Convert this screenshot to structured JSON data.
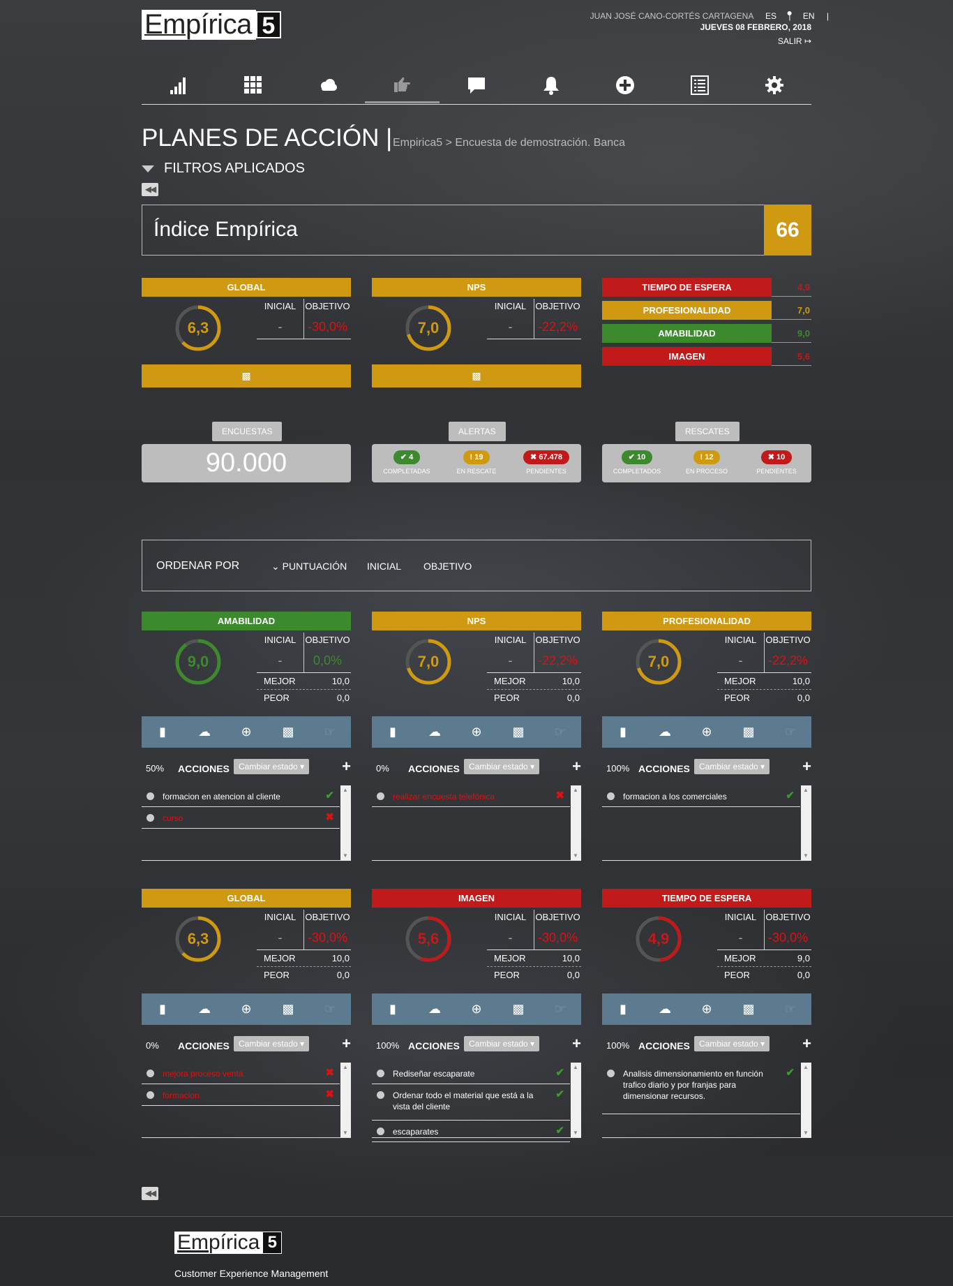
{
  "header": {
    "logo_word": "Empírica",
    "logo_num": "5",
    "user": "JUAN JOSÉ CANO-CORTÉS CARTAGENA",
    "lang_es": "ES",
    "lang_en": "EN",
    "sep": "|",
    "date": "JUEVES 08 FEBRERO, 2018",
    "logout": "SALIR"
  },
  "nav": [
    "bars-chart-icon",
    "grid-icon",
    "cloud-icon",
    "hand-pointer-icon",
    "speech-bubble-icon",
    "bell-icon",
    "plus-circle-icon",
    "list-icon",
    "gear-icon"
  ],
  "page": {
    "title": "PLANES DE ACCIÓN |",
    "breadcrumb": "Empirica5 > Encuesta de demostración. Banca",
    "filters": "FILTROS APLICADOS"
  },
  "indice": {
    "label": "Índice Empírica",
    "value": "66"
  },
  "kpi": [
    {
      "name": "GLOBAL",
      "score": "6,3",
      "inicial": "-",
      "objetivo": "-30,0%",
      "level": 0.63
    },
    {
      "name": "NPS",
      "score": "7,0",
      "inicial": "-",
      "objetivo": "-22,2%",
      "level": 0.7
    }
  ],
  "labels": {
    "inicial": "INICIAL",
    "objetivo": "OBJETIVO",
    "mejor": "MEJOR",
    "peor": "PEOR",
    "acciones": "ACCIONES",
    "cambiar": "Cambiar estado",
    "plus": "+"
  },
  "side_metrics": [
    {
      "name": "TIEMPO DE ESPERA",
      "value": "4,9",
      "color": "#c01a1a"
    },
    {
      "name": "PROFESIONALIDAD",
      "value": "7,0",
      "color": "#cf9a12"
    },
    {
      "name": "AMABILIDAD",
      "value": "9,0",
      "color": "#3d8a2e"
    },
    {
      "name": "IMAGEN",
      "value": "5,6",
      "color": "#c01a1a"
    }
  ],
  "counters": {
    "encuestas": {
      "label": "ENCUESTAS",
      "value": "90.000"
    },
    "alertas": {
      "label": "ALERTAS",
      "items": [
        {
          "count": "4",
          "label": "COMPLETADAS"
        },
        {
          "count": "19",
          "label": "EN RESCATE"
        },
        {
          "count": "67.478",
          "label": "PENDIENTES"
        }
      ]
    },
    "rescates": {
      "label": "RESCATES",
      "items": [
        {
          "count": "10",
          "label": "COMPLETADOS"
        },
        {
          "count": "12",
          "label": "EN PROCESO"
        },
        {
          "count": "10",
          "label": "PENDIENTES"
        }
      ]
    }
  },
  "orden": {
    "label": "ORDENAR POR",
    "options": [
      "PUNTUACIÓN",
      "INICIAL",
      "OBJETIVO"
    ]
  },
  "plans": [
    {
      "name": "AMABILIDAD",
      "score": "9,0",
      "inicial": "-",
      "objetivo": "0,0%",
      "mejor": "10,0",
      "peor": "0,0",
      "pct": "50%",
      "level": 0.9,
      "actions": [
        {
          "text": "formacion en atencion al cliente",
          "done": true
        },
        {
          "text": "curso",
          "done": false
        }
      ]
    },
    {
      "name": "NPS",
      "score": "7,0",
      "inicial": "-",
      "objetivo": "-22,2%",
      "mejor": "10,0",
      "peor": "0,0",
      "pct": "0%",
      "level": 0.7,
      "actions": [
        {
          "text": "realizar encuesta telefónica",
          "done": false
        }
      ]
    },
    {
      "name": "PROFESIONALIDAD",
      "score": "7,0",
      "inicial": "-",
      "objetivo": "-22,2%",
      "mejor": "10,0",
      "peor": "0,0",
      "pct": "100%",
      "level": 0.7,
      "actions": [
        {
          "text": "formacion a los comerciales",
          "done": true
        }
      ]
    },
    {
      "name": "GLOBAL",
      "score": "6,3",
      "inicial": "-",
      "objetivo": "-30,0%",
      "mejor": "10,0",
      "peor": "0,0",
      "pct": "0%",
      "level": 0.63,
      "actions": [
        {
          "text": "mejora proceso venta",
          "done": false
        },
        {
          "text": "formacion",
          "done": false
        }
      ]
    },
    {
      "name": "IMAGEN",
      "score": "5,6",
      "inicial": "-",
      "objetivo": "-30,0%",
      "mejor": "10,0",
      "peor": "0,0",
      "pct": "100%",
      "level": 0.56,
      "actions": [
        {
          "text": "Rediseñar escaparate",
          "done": true
        },
        {
          "text": "Ordenar todo el material que está a la vista del cliente",
          "done": true
        },
        {
          "text": "escaparates",
          "done": true
        }
      ]
    },
    {
      "name": "TIEMPO DE ESPERA",
      "score": "4,9",
      "inicial": "-",
      "objetivo": "-30,0%",
      "mejor": "9,0",
      "peor": "0,0",
      "pct": "100%",
      "level": 0.49,
      "actions": [
        {
          "text": "Analisis dimensionamiento en función trafico diario y por franjas para dimensionar recursos.",
          "done": true
        }
      ]
    }
  ],
  "colors": {
    "gold": "#cf9a12",
    "green": "#3d8a2e",
    "red": "#c01a1a",
    "toolbar": "#5d7b8f"
  },
  "footer": {
    "tagline": "Customer Experience Management"
  }
}
